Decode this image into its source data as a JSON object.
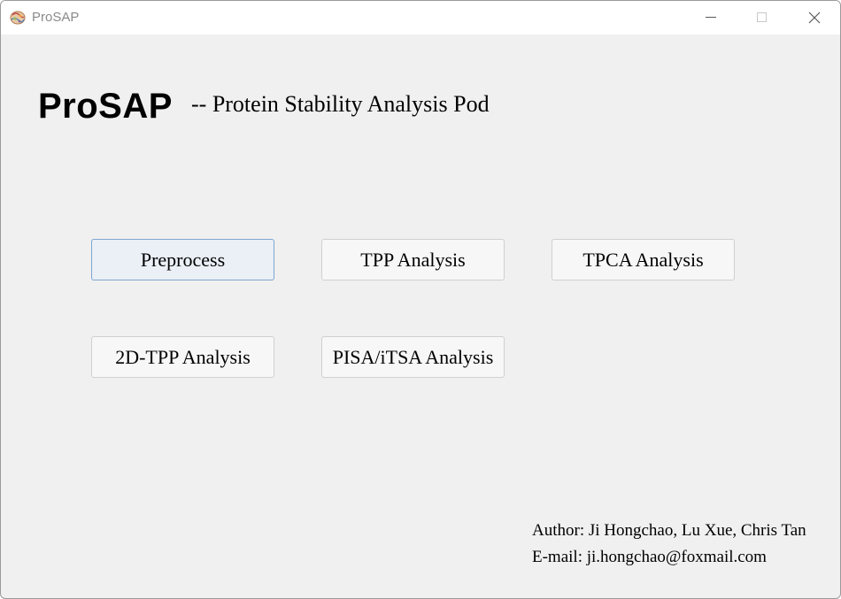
{
  "window": {
    "title": "ProSAP",
    "icon": "prosap-app-icon",
    "controls": {
      "minimize_icon": "minimize-icon",
      "maximize_icon": "maximize-icon",
      "close_icon": "close-icon"
    }
  },
  "header": {
    "logo": "ProSAP",
    "subtitle": "-- Protein Stability Analysis Pod"
  },
  "buttons": [
    {
      "label": "Preprocess",
      "focused": true
    },
    {
      "label": "TPP Analysis",
      "focused": false
    },
    {
      "label": "TPCA Analysis",
      "focused": false
    },
    {
      "label": "2D-TPP Analysis",
      "focused": false
    },
    {
      "label": "PISA/iTSA Analysis",
      "focused": false
    }
  ],
  "footer": {
    "author": "Author: Ji Hongchao, Lu Xue, Chris Tan",
    "email": "E-mail: ji.hongchao@foxmail.com"
  },
  "colors": {
    "background": "#f0f0f0",
    "titlebar": "#ffffff",
    "button_bg": "#f7f7f7",
    "button_border": "#d0d0d0",
    "focused_border": "#7fa6d0",
    "focused_bg": "#eaf0f6"
  }
}
